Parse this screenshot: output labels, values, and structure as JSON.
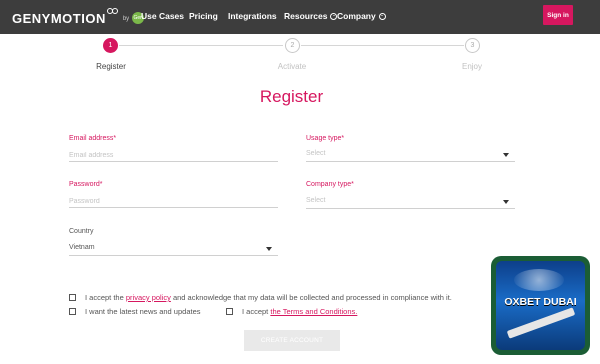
{
  "nav": {
    "logo_text": "GENYMOTION",
    "logo_by": "by",
    "logo_badge": "Gen",
    "items": [
      {
        "label": "Use Cases"
      },
      {
        "label": "Pricing"
      },
      {
        "label": "Integrations"
      },
      {
        "label": "Resources"
      },
      {
        "label": "Company"
      }
    ],
    "signin_label": "Sign in"
  },
  "stepper": {
    "steps": [
      {
        "number": "1",
        "label": "Register",
        "active": true
      },
      {
        "number": "2",
        "label": "Activate",
        "active": false
      },
      {
        "number": "3",
        "label": "Enjoy",
        "active": false
      }
    ]
  },
  "title": "Register",
  "form": {
    "email": {
      "label": "Email address*",
      "placeholder": "Email address"
    },
    "usage_type": {
      "label": "Usage type*",
      "value": "Select"
    },
    "password": {
      "label": "Password*",
      "placeholder": "Password"
    },
    "company_type": {
      "label": "Company type*",
      "value": "Select"
    },
    "country": {
      "label": "Country",
      "value": "Vietnam"
    }
  },
  "checks": {
    "privacy": {
      "before": "I accept the ",
      "link": "privacy policy",
      "after": " and acknowledge that my data will be collected and processed in compliance with it."
    },
    "news": {
      "label": "I want the latest news and updates"
    },
    "terms": {
      "before": "I accept ",
      "link": "the Terms and Conditions."
    }
  },
  "create_button": "CREATE ACCOUNT",
  "ad": {
    "text": "OXBET DUBAI"
  },
  "colors": {
    "accent": "#d6175f",
    "nav_bg": "#3d3d3d"
  }
}
